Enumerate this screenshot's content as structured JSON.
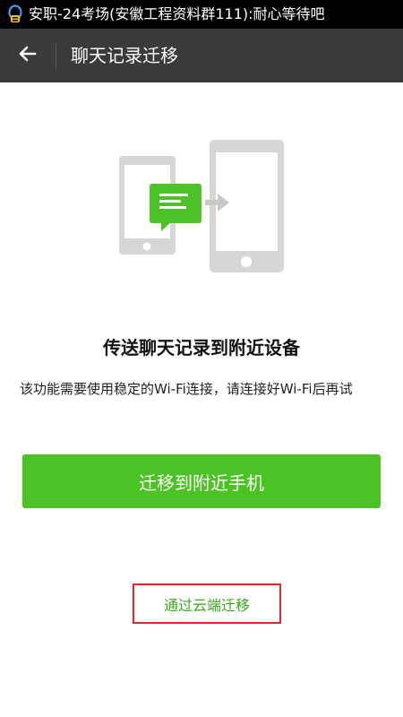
{
  "status_bar": {
    "text": "安职-24考场(安徽工程资料群111):耐心等待吧",
    "icon": "qq-penguin-icon"
  },
  "header": {
    "title": "聊天记录迁移",
    "back_icon": "arrow-left-icon"
  },
  "main": {
    "heading": "传送聊天记录到附近设备",
    "description": "该功能需要使用稳定的Wi-Fi连接，请连接好Wi-Fi后再试",
    "migrate_button_label": "迁移到附近手机",
    "cloud_link_label": "通过云端迁移"
  },
  "colors": {
    "accent_green": "#4cc324",
    "header_bg": "#3a3a3a",
    "highlight_red": "#e0262b",
    "link_green": "#3aa81a"
  }
}
